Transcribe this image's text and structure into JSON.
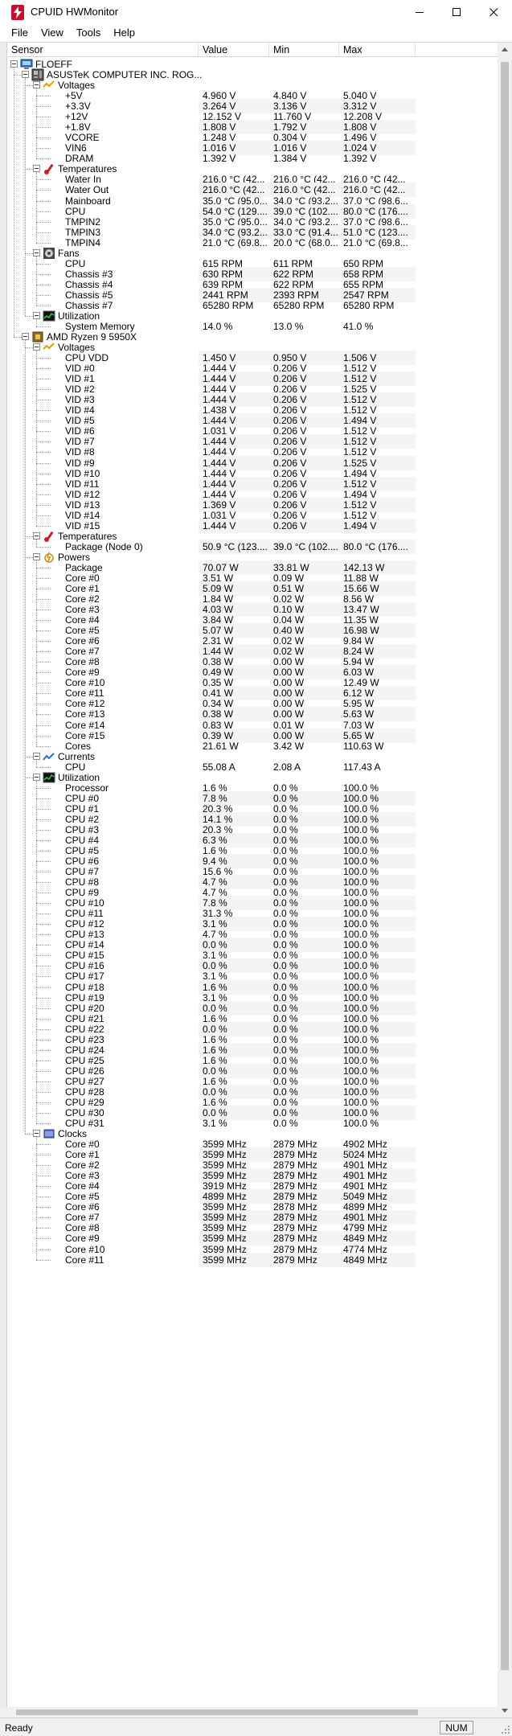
{
  "window": {
    "title": "CPUID HWMonitor"
  },
  "menu": [
    "File",
    "View",
    "Tools",
    "Help"
  ],
  "columns": {
    "sensor": "Sensor",
    "value": "Value",
    "min": "Min",
    "max": "Max"
  },
  "status": {
    "text": "Ready",
    "num": "NUM"
  },
  "rows": [
    {
      "d": 0,
      "t": "toggle",
      "icon": "computer-icon",
      "label": "FLOEFF"
    },
    {
      "d": 1,
      "t": "toggle",
      "icon": "motherboard-icon",
      "label": "ASUSTeK COMPUTER INC. ROG..."
    },
    {
      "d": 2,
      "t": "toggle",
      "icon": "voltage-icon",
      "label": "Voltages"
    },
    {
      "d": 3,
      "label": "+5V",
      "v": "4.960 V",
      "mn": "4.840 V",
      "mx": "5.040 V"
    },
    {
      "d": 3,
      "label": "+3.3V",
      "v": "3.264 V",
      "mn": "3.136 V",
      "mx": "3.312 V"
    },
    {
      "d": 3,
      "label": "+12V",
      "v": "12.152 V",
      "mn": "11.760 V",
      "mx": "12.208 V"
    },
    {
      "d": 3,
      "label": "+1.8V",
      "v": "1.808 V",
      "mn": "1.792 V",
      "mx": "1.808 V"
    },
    {
      "d": 3,
      "label": "VCORE",
      "v": "1.248 V",
      "mn": "0.304 V",
      "mx": "1.496 V"
    },
    {
      "d": 3,
      "label": "VIN6",
      "v": "1.016 V",
      "mn": "1.016 V",
      "mx": "1.024 V"
    },
    {
      "d": 3,
      "label": "DRAM",
      "v": "1.392 V",
      "mn": "1.384 V",
      "mx": "1.392 V"
    },
    {
      "d": 2,
      "t": "toggle",
      "icon": "thermometer-icon",
      "label": "Temperatures"
    },
    {
      "d": 3,
      "label": "Water In",
      "v": "216.0 °C  (42...",
      "mn": "216.0 °C  (42...",
      "mx": "216.0 °C  (42..."
    },
    {
      "d": 3,
      "label": "Water Out",
      "v": "216.0 °C  (42...",
      "mn": "216.0 °C  (42...",
      "mx": "216.0 °C  (42..."
    },
    {
      "d": 3,
      "label": "Mainboard",
      "v": "35.0 °C  (95.0...",
      "mn": "34.0 °C  (93.2...",
      "mx": "37.0 °C  (98.6..."
    },
    {
      "d": 3,
      "label": "CPU",
      "v": "54.0 °C  (129....",
      "mn": "39.0 °C  (102....",
      "mx": "80.0 °C  (176...."
    },
    {
      "d": 3,
      "label": "TMPIN2",
      "v": "35.0 °C  (95.0...",
      "mn": "34.0 °C  (93.2...",
      "mx": "37.0 °C  (98.6..."
    },
    {
      "d": 3,
      "label": "TMPIN3",
      "v": "34.0 °C  (93.2...",
      "mn": "33.0 °C  (91.4...",
      "mx": "51.0 °C  (123...."
    },
    {
      "d": 3,
      "label": "TMPIN4",
      "v": "21.0 °C  (69.8...",
      "mn": "20.0 °C  (68.0...",
      "mx": "21.0 °C  (69.8..."
    },
    {
      "d": 2,
      "t": "toggle",
      "icon": "fan-icon",
      "label": "Fans"
    },
    {
      "d": 3,
      "label": "CPU",
      "v": "615 RPM",
      "mn": "611 RPM",
      "mx": "650 RPM"
    },
    {
      "d": 3,
      "label": "Chassis #3",
      "v": "630 RPM",
      "mn": "622 RPM",
      "mx": "658 RPM"
    },
    {
      "d": 3,
      "label": "Chassis #4",
      "v": "639 RPM",
      "mn": "622 RPM",
      "mx": "655 RPM"
    },
    {
      "d": 3,
      "label": "Chassis #5",
      "v": "2441 RPM",
      "mn": "2393 RPM",
      "mx": "2547 RPM"
    },
    {
      "d": 3,
      "label": "Chassis #7",
      "v": "65280 RPM",
      "mn": "65280 RPM",
      "mx": "65280 RPM"
    },
    {
      "d": 2,
      "t": "toggle",
      "icon": "utilization-icon",
      "label": "Utilization"
    },
    {
      "d": 3,
      "label": "System Memory",
      "v": "14.0 %",
      "mn": "13.0 %",
      "mx": "41.0 %"
    },
    {
      "d": 1,
      "t": "toggle",
      "icon": "cpu-chip-icon",
      "label": "AMD Ryzen 9 5950X"
    },
    {
      "d": 2,
      "t": "toggle",
      "icon": "voltage-icon",
      "label": "Voltages"
    },
    {
      "d": 3,
      "label": "CPU VDD",
      "v": "1.450 V",
      "mn": "0.950 V",
      "mx": "1.506 V"
    },
    {
      "d": 3,
      "label": "VID #0",
      "v": "1.444 V",
      "mn": "0.206 V",
      "mx": "1.512 V"
    },
    {
      "d": 3,
      "label": "VID #1",
      "v": "1.444 V",
      "mn": "0.206 V",
      "mx": "1.512 V"
    },
    {
      "d": 3,
      "label": "VID #2",
      "v": "1.444 V",
      "mn": "0.206 V",
      "mx": "1.525 V"
    },
    {
      "d": 3,
      "label": "VID #3",
      "v": "1.444 V",
      "mn": "0.206 V",
      "mx": "1.512 V"
    },
    {
      "d": 3,
      "label": "VID #4",
      "v": "1.438 V",
      "mn": "0.206 V",
      "mx": "1.512 V"
    },
    {
      "d": 3,
      "label": "VID #5",
      "v": "1.444 V",
      "mn": "0.206 V",
      "mx": "1.494 V"
    },
    {
      "d": 3,
      "label": "VID #6",
      "v": "1.031 V",
      "mn": "0.206 V",
      "mx": "1.512 V"
    },
    {
      "d": 3,
      "label": "VID #7",
      "v": "1.444 V",
      "mn": "0.206 V",
      "mx": "1.512 V"
    },
    {
      "d": 3,
      "label": "VID #8",
      "v": "1.444 V",
      "mn": "0.206 V",
      "mx": "1.512 V"
    },
    {
      "d": 3,
      "label": "VID #9",
      "v": "1.444 V",
      "mn": "0.206 V",
      "mx": "1.525 V"
    },
    {
      "d": 3,
      "label": "VID #10",
      "v": "1.444 V",
      "mn": "0.206 V",
      "mx": "1.494 V"
    },
    {
      "d": 3,
      "label": "VID #11",
      "v": "1.444 V",
      "mn": "0.206 V",
      "mx": "1.512 V"
    },
    {
      "d": 3,
      "label": "VID #12",
      "v": "1.444 V",
      "mn": "0.206 V",
      "mx": "1.494 V"
    },
    {
      "d": 3,
      "label": "VID #13",
      "v": "1.369 V",
      "mn": "0.206 V",
      "mx": "1.512 V"
    },
    {
      "d": 3,
      "label": "VID #14",
      "v": "1.031 V",
      "mn": "0.206 V",
      "mx": "1.512 V"
    },
    {
      "d": 3,
      "label": "VID #15",
      "v": "1.444 V",
      "mn": "0.206 V",
      "mx": "1.494 V"
    },
    {
      "d": 2,
      "t": "toggle",
      "icon": "thermometer-icon",
      "label": "Temperatures"
    },
    {
      "d": 3,
      "label": "Package (Node 0)",
      "v": "50.9 °C  (123....",
      "mn": "39.0 °C  (102....",
      "mx": "80.0 °C  (176...."
    },
    {
      "d": 2,
      "t": "toggle",
      "icon": "power-icon",
      "label": "Powers"
    },
    {
      "d": 3,
      "label": "Package",
      "v": "70.07 W",
      "mn": "33.81 W",
      "mx": "142.13 W"
    },
    {
      "d": 3,
      "label": "Core #0",
      "v": "3.51 W",
      "mn": "0.09 W",
      "mx": "11.88 W"
    },
    {
      "d": 3,
      "label": "Core #1",
      "v": "5.09 W",
      "mn": "0.51 W",
      "mx": "15.66 W"
    },
    {
      "d": 3,
      "label": "Core #2",
      "v": "1.84 W",
      "mn": "0.02 W",
      "mx": "8.56 W"
    },
    {
      "d": 3,
      "label": "Core #3",
      "v": "4.03 W",
      "mn": "0.10 W",
      "mx": "13.47 W"
    },
    {
      "d": 3,
      "label": "Core #4",
      "v": "3.84 W",
      "mn": "0.04 W",
      "mx": "11.35 W"
    },
    {
      "d": 3,
      "label": "Core #5",
      "v": "5.07 W",
      "mn": "0.40 W",
      "mx": "16.98 W"
    },
    {
      "d": 3,
      "label": "Core #6",
      "v": "2.31 W",
      "mn": "0.02 W",
      "mx": "9.84 W"
    },
    {
      "d": 3,
      "label": "Core #7",
      "v": "1.44 W",
      "mn": "0.02 W",
      "mx": "8.24 W"
    },
    {
      "d": 3,
      "label": "Core #8",
      "v": "0.38 W",
      "mn": "0.00 W",
      "mx": "5.94 W"
    },
    {
      "d": 3,
      "label": "Core #9",
      "v": "0.49 W",
      "mn": "0.00 W",
      "mx": "6.03 W"
    },
    {
      "d": 3,
      "label": "Core #10",
      "v": "0.35 W",
      "mn": "0.00 W",
      "mx": "12.49 W"
    },
    {
      "d": 3,
      "label": "Core #11",
      "v": "0.41 W",
      "mn": "0.00 W",
      "mx": "6.12 W"
    },
    {
      "d": 3,
      "label": "Core #12",
      "v": "0.34 W",
      "mn": "0.00 W",
      "mx": "5.95 W"
    },
    {
      "d": 3,
      "label": "Core #13",
      "v": "0.38 W",
      "mn": "0.00 W",
      "mx": "5.63 W"
    },
    {
      "d": 3,
      "label": "Core #14",
      "v": "0.83 W",
      "mn": "0.01 W",
      "mx": "7.03 W"
    },
    {
      "d": 3,
      "label": "Core #15",
      "v": "0.39 W",
      "mn": "0.00 W",
      "mx": "5.65 W"
    },
    {
      "d": 3,
      "label": "Cores",
      "v": "21.61 W",
      "mn": "3.42 W",
      "mx": "110.63 W"
    },
    {
      "d": 2,
      "t": "toggle",
      "icon": "current-icon",
      "label": "Currents"
    },
    {
      "d": 3,
      "label": "CPU",
      "v": "55.08 A",
      "mn": "2.08 A",
      "mx": "117.43 A"
    },
    {
      "d": 2,
      "t": "toggle",
      "icon": "utilization-icon",
      "label": "Utilization"
    },
    {
      "d": 3,
      "label": "Processor",
      "v": "1.6 %",
      "mn": "0.0 %",
      "mx": "100.0 %"
    },
    {
      "d": 3,
      "label": "CPU #0",
      "v": "7.8 %",
      "mn": "0.0 %",
      "mx": "100.0 %"
    },
    {
      "d": 3,
      "label": "CPU #1",
      "v": "20.3 %",
      "mn": "0.0 %",
      "mx": "100.0 %"
    },
    {
      "d": 3,
      "label": "CPU #2",
      "v": "14.1 %",
      "mn": "0.0 %",
      "mx": "100.0 %"
    },
    {
      "d": 3,
      "label": "CPU #3",
      "v": "20.3 %",
      "mn": "0.0 %",
      "mx": "100.0 %"
    },
    {
      "d": 3,
      "label": "CPU #4",
      "v": "6.3 %",
      "mn": "0.0 %",
      "mx": "100.0 %"
    },
    {
      "d": 3,
      "label": "CPU #5",
      "v": "1.6 %",
      "mn": "0.0 %",
      "mx": "100.0 %"
    },
    {
      "d": 3,
      "label": "CPU #6",
      "v": "9.4 %",
      "mn": "0.0 %",
      "mx": "100.0 %"
    },
    {
      "d": 3,
      "label": "CPU #7",
      "v": "15.6 %",
      "mn": "0.0 %",
      "mx": "100.0 %"
    },
    {
      "d": 3,
      "label": "CPU #8",
      "v": "4.7 %",
      "mn": "0.0 %",
      "mx": "100.0 %"
    },
    {
      "d": 3,
      "label": "CPU #9",
      "v": "4.7 %",
      "mn": "0.0 %",
      "mx": "100.0 %"
    },
    {
      "d": 3,
      "label": "CPU #10",
      "v": "7.8 %",
      "mn": "0.0 %",
      "mx": "100.0 %"
    },
    {
      "d": 3,
      "label": "CPU #11",
      "v": "31.3 %",
      "mn": "0.0 %",
      "mx": "100.0 %"
    },
    {
      "d": 3,
      "label": "CPU #12",
      "v": "3.1 %",
      "mn": "0.0 %",
      "mx": "100.0 %"
    },
    {
      "d": 3,
      "label": "CPU #13",
      "v": "4.7 %",
      "mn": "0.0 %",
      "mx": "100.0 %"
    },
    {
      "d": 3,
      "label": "CPU #14",
      "v": "0.0 %",
      "mn": "0.0 %",
      "mx": "100.0 %"
    },
    {
      "d": 3,
      "label": "CPU #15",
      "v": "3.1 %",
      "mn": "0.0 %",
      "mx": "100.0 %"
    },
    {
      "d": 3,
      "label": "CPU #16",
      "v": "0.0 %",
      "mn": "0.0 %",
      "mx": "100.0 %"
    },
    {
      "d": 3,
      "label": "CPU #17",
      "v": "3.1 %",
      "mn": "0.0 %",
      "mx": "100.0 %"
    },
    {
      "d": 3,
      "label": "CPU #18",
      "v": "1.6 %",
      "mn": "0.0 %",
      "mx": "100.0 %"
    },
    {
      "d": 3,
      "label": "CPU #19",
      "v": "3.1 %",
      "mn": "0.0 %",
      "mx": "100.0 %"
    },
    {
      "d": 3,
      "label": "CPU #20",
      "v": "0.0 %",
      "mn": "0.0 %",
      "mx": "100.0 %"
    },
    {
      "d": 3,
      "label": "CPU #21",
      "v": "1.6 %",
      "mn": "0.0 %",
      "mx": "100.0 %"
    },
    {
      "d": 3,
      "label": "CPU #22",
      "v": "0.0 %",
      "mn": "0.0 %",
      "mx": "100.0 %"
    },
    {
      "d": 3,
      "label": "CPU #23",
      "v": "1.6 %",
      "mn": "0.0 %",
      "mx": "100.0 %"
    },
    {
      "d": 3,
      "label": "CPU #24",
      "v": "1.6 %",
      "mn": "0.0 %",
      "mx": "100.0 %"
    },
    {
      "d": 3,
      "label": "CPU #25",
      "v": "1.6 %",
      "mn": "0.0 %",
      "mx": "100.0 %"
    },
    {
      "d": 3,
      "label": "CPU #26",
      "v": "0.0 %",
      "mn": "0.0 %",
      "mx": "100.0 %"
    },
    {
      "d": 3,
      "label": "CPU #27",
      "v": "1.6 %",
      "mn": "0.0 %",
      "mx": "100.0 %"
    },
    {
      "d": 3,
      "label": "CPU #28",
      "v": "0.0 %",
      "mn": "0.0 %",
      "mx": "100.0 %"
    },
    {
      "d": 3,
      "label": "CPU #29",
      "v": "1.6 %",
      "mn": "0.0 %",
      "mx": "100.0 %"
    },
    {
      "d": 3,
      "label": "CPU #30",
      "v": "0.0 %",
      "mn": "0.0 %",
      "mx": "100.0 %"
    },
    {
      "d": 3,
      "label": "CPU #31",
      "v": "3.1 %",
      "mn": "0.0 %",
      "mx": "100.0 %"
    },
    {
      "d": 2,
      "t": "toggle",
      "icon": "clock-icon",
      "label": "Clocks"
    },
    {
      "d": 3,
      "label": "Core #0",
      "v": "3599 MHz",
      "mn": "2879 MHz",
      "mx": "4902 MHz"
    },
    {
      "d": 3,
      "label": "Core #1",
      "v": "3599 MHz",
      "mn": "2879 MHz",
      "mx": "5024 MHz"
    },
    {
      "d": 3,
      "label": "Core #2",
      "v": "3599 MHz",
      "mn": "2879 MHz",
      "mx": "4901 MHz"
    },
    {
      "d": 3,
      "label": "Core #3",
      "v": "3599 MHz",
      "mn": "2879 MHz",
      "mx": "4901 MHz"
    },
    {
      "d": 3,
      "label": "Core #4",
      "v": "3919 MHz",
      "mn": "2879 MHz",
      "mx": "4901 MHz"
    },
    {
      "d": 3,
      "label": "Core #5",
      "v": "4899 MHz",
      "mn": "2879 MHz",
      "mx": "5049 MHz"
    },
    {
      "d": 3,
      "label": "Core #6",
      "v": "3599 MHz",
      "mn": "2878 MHz",
      "mx": "4899 MHz"
    },
    {
      "d": 3,
      "label": "Core #7",
      "v": "3599 MHz",
      "mn": "2879 MHz",
      "mx": "4901 MHz"
    },
    {
      "d": 3,
      "label": "Core #8",
      "v": "3599 MHz",
      "mn": "2879 MHz",
      "mx": "4799 MHz"
    },
    {
      "d": 3,
      "label": "Core #9",
      "v": "3599 MHz",
      "mn": "2879 MHz",
      "mx": "4849 MHz"
    },
    {
      "d": 3,
      "label": "Core #10",
      "v": "3599 MHz",
      "mn": "2879 MHz",
      "mx": "4774 MHz"
    },
    {
      "d": 3,
      "label": "Core #11",
      "v": "3599 MHz",
      "mn": "2879 MHz",
      "mx": "4849 MHz"
    }
  ]
}
